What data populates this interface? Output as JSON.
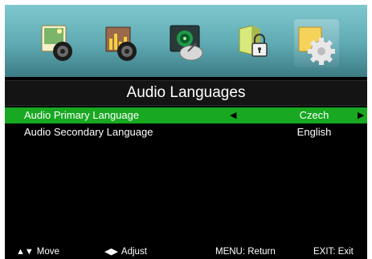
{
  "menu": {
    "icons": [
      {
        "name": "picture-icon"
      },
      {
        "name": "sound-icon"
      },
      {
        "name": "channel-icon"
      },
      {
        "name": "lock-icon"
      },
      {
        "name": "setup-gear-icon",
        "selected": true
      }
    ]
  },
  "title": "Audio Languages",
  "items": [
    {
      "label": "Audio Primary Language",
      "value": "Czech",
      "selected": true
    },
    {
      "label": "Audio Secondary Language",
      "value": "English",
      "selected": false
    }
  ],
  "footer": {
    "move_label": "Move",
    "adjust_label": "Adjust",
    "menu_label": "MENU: Return",
    "exit_label": "EXIT: Exit"
  },
  "colors": {
    "selection": "#18a821",
    "icon_bar": "#5fa9b2",
    "background": "#000000"
  }
}
